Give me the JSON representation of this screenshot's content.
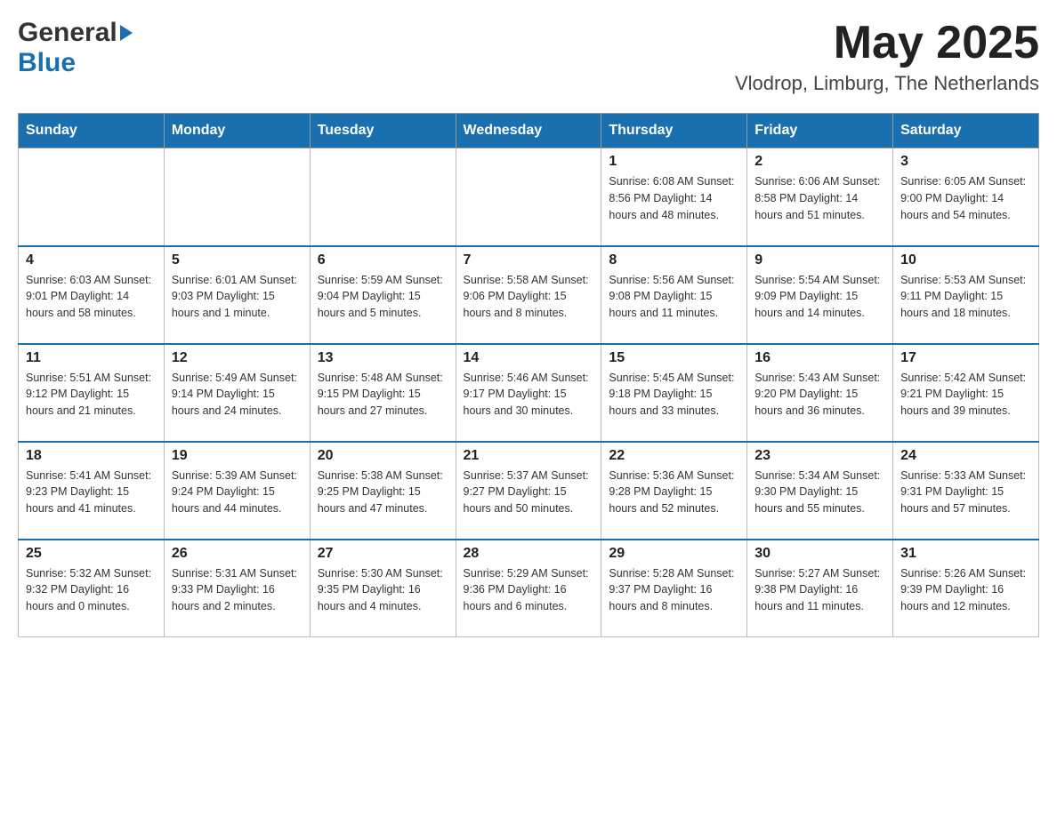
{
  "header": {
    "logo_general": "General",
    "logo_blue": "Blue",
    "month_title": "May 2025",
    "subtitle": "Vlodrop, Limburg, The Netherlands"
  },
  "days_of_week": [
    "Sunday",
    "Monday",
    "Tuesday",
    "Wednesday",
    "Thursday",
    "Friday",
    "Saturday"
  ],
  "weeks": [
    {
      "days": [
        {
          "number": "",
          "info": ""
        },
        {
          "number": "",
          "info": ""
        },
        {
          "number": "",
          "info": ""
        },
        {
          "number": "",
          "info": ""
        },
        {
          "number": "1",
          "info": "Sunrise: 6:08 AM\nSunset: 8:56 PM\nDaylight: 14 hours\nand 48 minutes."
        },
        {
          "number": "2",
          "info": "Sunrise: 6:06 AM\nSunset: 8:58 PM\nDaylight: 14 hours\nand 51 minutes."
        },
        {
          "number": "3",
          "info": "Sunrise: 6:05 AM\nSunset: 9:00 PM\nDaylight: 14 hours\nand 54 minutes."
        }
      ]
    },
    {
      "days": [
        {
          "number": "4",
          "info": "Sunrise: 6:03 AM\nSunset: 9:01 PM\nDaylight: 14 hours\nand 58 minutes."
        },
        {
          "number": "5",
          "info": "Sunrise: 6:01 AM\nSunset: 9:03 PM\nDaylight: 15 hours\nand 1 minute."
        },
        {
          "number": "6",
          "info": "Sunrise: 5:59 AM\nSunset: 9:04 PM\nDaylight: 15 hours\nand 5 minutes."
        },
        {
          "number": "7",
          "info": "Sunrise: 5:58 AM\nSunset: 9:06 PM\nDaylight: 15 hours\nand 8 minutes."
        },
        {
          "number": "8",
          "info": "Sunrise: 5:56 AM\nSunset: 9:08 PM\nDaylight: 15 hours\nand 11 minutes."
        },
        {
          "number": "9",
          "info": "Sunrise: 5:54 AM\nSunset: 9:09 PM\nDaylight: 15 hours\nand 14 minutes."
        },
        {
          "number": "10",
          "info": "Sunrise: 5:53 AM\nSunset: 9:11 PM\nDaylight: 15 hours\nand 18 minutes."
        }
      ]
    },
    {
      "days": [
        {
          "number": "11",
          "info": "Sunrise: 5:51 AM\nSunset: 9:12 PM\nDaylight: 15 hours\nand 21 minutes."
        },
        {
          "number": "12",
          "info": "Sunrise: 5:49 AM\nSunset: 9:14 PM\nDaylight: 15 hours\nand 24 minutes."
        },
        {
          "number": "13",
          "info": "Sunrise: 5:48 AM\nSunset: 9:15 PM\nDaylight: 15 hours\nand 27 minutes."
        },
        {
          "number": "14",
          "info": "Sunrise: 5:46 AM\nSunset: 9:17 PM\nDaylight: 15 hours\nand 30 minutes."
        },
        {
          "number": "15",
          "info": "Sunrise: 5:45 AM\nSunset: 9:18 PM\nDaylight: 15 hours\nand 33 minutes."
        },
        {
          "number": "16",
          "info": "Sunrise: 5:43 AM\nSunset: 9:20 PM\nDaylight: 15 hours\nand 36 minutes."
        },
        {
          "number": "17",
          "info": "Sunrise: 5:42 AM\nSunset: 9:21 PM\nDaylight: 15 hours\nand 39 minutes."
        }
      ]
    },
    {
      "days": [
        {
          "number": "18",
          "info": "Sunrise: 5:41 AM\nSunset: 9:23 PM\nDaylight: 15 hours\nand 41 minutes."
        },
        {
          "number": "19",
          "info": "Sunrise: 5:39 AM\nSunset: 9:24 PM\nDaylight: 15 hours\nand 44 minutes."
        },
        {
          "number": "20",
          "info": "Sunrise: 5:38 AM\nSunset: 9:25 PM\nDaylight: 15 hours\nand 47 minutes."
        },
        {
          "number": "21",
          "info": "Sunrise: 5:37 AM\nSunset: 9:27 PM\nDaylight: 15 hours\nand 50 minutes."
        },
        {
          "number": "22",
          "info": "Sunrise: 5:36 AM\nSunset: 9:28 PM\nDaylight: 15 hours\nand 52 minutes."
        },
        {
          "number": "23",
          "info": "Sunrise: 5:34 AM\nSunset: 9:30 PM\nDaylight: 15 hours\nand 55 minutes."
        },
        {
          "number": "24",
          "info": "Sunrise: 5:33 AM\nSunset: 9:31 PM\nDaylight: 15 hours\nand 57 minutes."
        }
      ]
    },
    {
      "days": [
        {
          "number": "25",
          "info": "Sunrise: 5:32 AM\nSunset: 9:32 PM\nDaylight: 16 hours\nand 0 minutes."
        },
        {
          "number": "26",
          "info": "Sunrise: 5:31 AM\nSunset: 9:33 PM\nDaylight: 16 hours\nand 2 minutes."
        },
        {
          "number": "27",
          "info": "Sunrise: 5:30 AM\nSunset: 9:35 PM\nDaylight: 16 hours\nand 4 minutes."
        },
        {
          "number": "28",
          "info": "Sunrise: 5:29 AM\nSunset: 9:36 PM\nDaylight: 16 hours\nand 6 minutes."
        },
        {
          "number": "29",
          "info": "Sunrise: 5:28 AM\nSunset: 9:37 PM\nDaylight: 16 hours\nand 8 minutes."
        },
        {
          "number": "30",
          "info": "Sunrise: 5:27 AM\nSunset: 9:38 PM\nDaylight: 16 hours\nand 11 minutes."
        },
        {
          "number": "31",
          "info": "Sunrise: 5:26 AM\nSunset: 9:39 PM\nDaylight: 16 hours\nand 12 minutes."
        }
      ]
    }
  ]
}
